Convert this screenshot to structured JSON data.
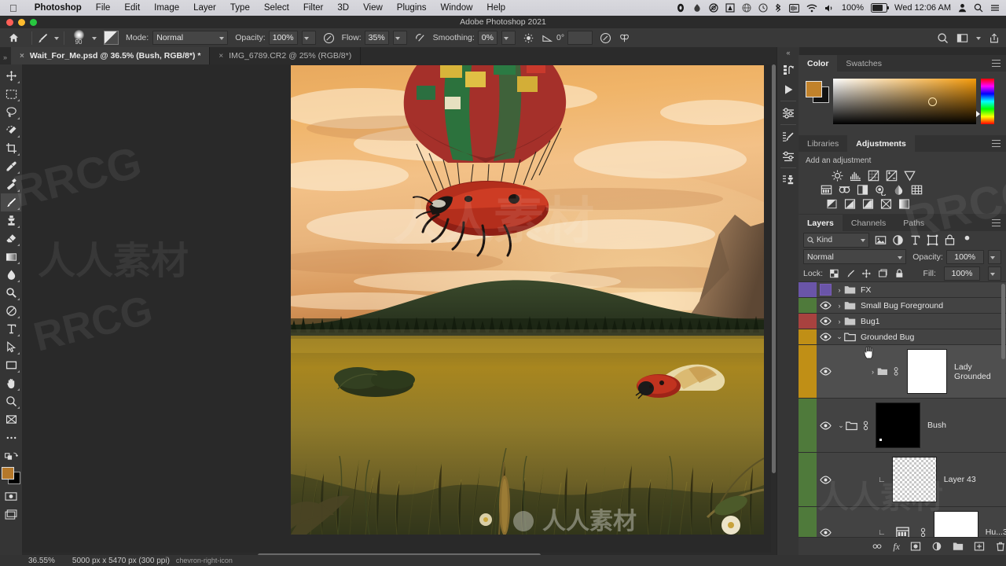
{
  "macbar": {
    "apple_icon": "apple-icon",
    "app_name": "Photoshop",
    "menus": [
      "File",
      "Edit",
      "Image",
      "Layer",
      "Type",
      "Select",
      "Filter",
      "3D",
      "View",
      "Plugins",
      "Window",
      "Help"
    ],
    "status_icons": [
      "dropbox-icon",
      "creative-cloud-icon",
      "adobe-icon",
      "globe-icon",
      "time-machine-icon",
      "bluetooth-icon",
      "battery-time-icon",
      "wifi-icon",
      "volume-icon"
    ],
    "battery_percent": "100%",
    "clock": "Wed 12:06 AM",
    "user_icon": "user-icon",
    "search_icon": "spotlight-search-icon",
    "control_center_icon": "control-center-icon"
  },
  "window": {
    "title": "Adobe Photoshop 2021"
  },
  "options_bar": {
    "home_icon": "home-icon",
    "tool_icon": "brush-tool-icon",
    "brush_size": "90",
    "brush_preset_icon": "brush-preset-picker-icon",
    "mode_label": "Mode:",
    "mode_value": "Normal",
    "opacity_label": "Opacity:",
    "opacity_value": "100%",
    "opacity_pressure_icon": "pressure-opacity-icon",
    "flow_label": "Flow:",
    "flow_value": "35%",
    "airbrush_icon": "airbrush-icon",
    "smoothing_label": "Smoothing:",
    "smoothing_value": "0%",
    "smoothing_options_icon": "smoothing-options-gear-icon",
    "angle_icon": "brush-angle-icon",
    "angle_value": "0°",
    "tablet_pressure_icon": "tablet-pressure-size-icon",
    "symmetry_icon": "symmetry-butterfly-icon",
    "search_icon": "search-icon",
    "workspace_icon": "workspace-switcher-icon",
    "share_icon": "share-icon"
  },
  "tabs": {
    "expander_icon": "double-chevron-icon",
    "items": [
      {
        "label": "Wait_For_Me.psd @ 36.5% (Bush, RGB/8*) *",
        "active": true,
        "close_icon": "close-icon"
      },
      {
        "label": "IMG_6789.CR2 @ 25% (RGB/8*)",
        "active": false,
        "close_icon": "close-icon"
      }
    ]
  },
  "toolbar": {
    "tools": [
      {
        "name": "move-tool-icon",
        "selected": false
      },
      {
        "name": "rectangular-marquee-tool-icon",
        "selected": false
      },
      {
        "name": "lasso-tool-icon",
        "selected": false
      },
      {
        "name": "object-selection-tool-icon",
        "selected": false
      },
      {
        "name": "crop-tool-icon",
        "selected": false
      },
      {
        "name": "eyedropper-tool-icon",
        "selected": false
      },
      {
        "name": "spot-healing-brush-tool-icon",
        "selected": false
      },
      {
        "name": "brush-tool-icon",
        "selected": true
      },
      {
        "name": "clone-stamp-tool-icon",
        "selected": false
      },
      {
        "name": "eraser-tool-icon",
        "selected": false
      },
      {
        "name": "gradient-tool-icon",
        "selected": false
      },
      {
        "name": "blur-tool-icon",
        "selected": false
      },
      {
        "name": "dodge-tool-icon",
        "selected": false
      },
      {
        "name": "pen-tool-icon",
        "selected": false
      },
      {
        "name": "type-tool-icon",
        "selected": false
      },
      {
        "name": "path-selection-tool-icon",
        "selected": false
      },
      {
        "name": "rectangle-tool-icon",
        "selected": false
      },
      {
        "name": "hand-tool-icon",
        "selected": false
      },
      {
        "name": "zoom-tool-icon",
        "selected": false
      },
      {
        "name": "edit-toolbar-icon",
        "selected": false
      },
      {
        "name": "more-tools-icon",
        "selected": false
      },
      {
        "name": "default-colors-icon",
        "selected": false
      }
    ],
    "foreground_color": "#b5782a",
    "background_color": "#000000",
    "quick_mask_icon": "quick-mask-mode-icon",
    "screen_mode_icon": "screen-mode-icon"
  },
  "canvas": {
    "description": "Surreal photo composite: hot air balloon with ladybug gondola flying over a sunset meadow and pine forest",
    "watermarks": [
      "RRCG",
      "人人素材"
    ]
  },
  "status_bar": {
    "zoom": "36.55%",
    "doc_size": "5000 px x 5470 px (300 ppi)",
    "expand_icon": "chevron-right-icon"
  },
  "dock_rail": {
    "collapse_icon": "double-chevron-left-icon",
    "items": [
      "history-icon",
      "play-actions-icon",
      "properties-icon",
      "brush-settings-icon",
      "brushes-icon",
      "clone-source-icon"
    ]
  },
  "color_panel": {
    "tabs": [
      {
        "label": "Color",
        "active": true
      },
      {
        "label": "Swatches",
        "active": false
      }
    ],
    "menu_icon": "panel-menu-icon",
    "foreground_swatch": "#c1822b",
    "background_swatch": "#111111",
    "picker_ring_icon": "color-picker-ring-icon",
    "hue_slider_icon": "hue-slider-icon"
  },
  "adjustments_panel": {
    "tabs": [
      {
        "label": "Libraries",
        "active": false
      },
      {
        "label": "Adjustments",
        "active": true
      }
    ],
    "menu_icon": "panel-menu-icon",
    "heading": "Add an adjustment",
    "row1": [
      "brightness-contrast-icon",
      "levels-icon",
      "curves-icon",
      "exposure-icon",
      "vibrance-icon"
    ],
    "row2": [
      "hue-saturation-icon",
      "color-balance-icon",
      "black-white-icon",
      "photo-filter-icon",
      "channel-mixer-icon",
      "color-lookup-icon"
    ],
    "row3": [
      "invert-icon",
      "posterize-icon",
      "threshold-icon",
      "selective-color-icon",
      "gradient-map-icon"
    ]
  },
  "layers_panel": {
    "tabs": [
      {
        "label": "Layers",
        "active": true
      },
      {
        "label": "Channels",
        "active": false
      },
      {
        "label": "Paths",
        "active": false
      }
    ],
    "menu_icon": "panel-menu-icon",
    "filter": {
      "search_icon": "search-icon",
      "kind_label": "Kind",
      "chevron_icon": "chevron-down-icon",
      "filter_icons": [
        "filter-pixel-icon",
        "filter-adjustment-icon",
        "filter-type-icon",
        "filter-shape-icon",
        "filter-smart-object-icon"
      ],
      "toggle_icon": "filter-toggle-icon"
    },
    "blend_mode": "Normal",
    "opacity_label": "Opacity:",
    "opacity_value": "100%",
    "lock_label": "Lock:",
    "lock_icons": [
      "lock-transparent-pixels-icon",
      "lock-image-pixels-icon",
      "lock-position-icon",
      "lock-artboard-nesting-icon",
      "lock-all-icon"
    ],
    "fill_label": "Fill:",
    "fill_value": "100%",
    "layers": [
      {
        "name": "FX",
        "type": "group",
        "color": "#6a55a8",
        "visible": false,
        "expanded": false,
        "twisty": "›"
      },
      {
        "name": "Small Bug Foreground",
        "type": "group",
        "color": "#4f7a3b",
        "visible": true,
        "expanded": false,
        "twisty": "›"
      },
      {
        "name": "Bug1",
        "type": "group",
        "color": "#a8423f",
        "visible": true,
        "expanded": false,
        "twisty": "›"
      },
      {
        "name": "Grounded Bug",
        "type": "group",
        "color": "#c08f16",
        "visible": true,
        "expanded": true,
        "twisty": "⌄"
      },
      {
        "name": "Lady Grounded",
        "type": "group-nested",
        "color": "#c08f16",
        "visible": true,
        "expanded": false,
        "twisty": "›",
        "thumb": "white",
        "has_mask_link": true,
        "selected": true
      },
      {
        "name": "Bush",
        "type": "group-nested",
        "color": "#4f7a3b",
        "visible": true,
        "expanded": true,
        "twisty": "⌄",
        "thumb": "black",
        "has_mask_link": true
      },
      {
        "name": "Layer 43",
        "type": "layer",
        "color": "#4f7a3b",
        "visible": true,
        "thumb": "checker",
        "clipped": true
      },
      {
        "name": "Hu...3",
        "type": "adjustment",
        "color": "#4f7a3b",
        "visible": true,
        "thumb": "white",
        "clipped": true,
        "adjustment_icon": "hue-saturation-icon",
        "has_mask_link": true
      }
    ],
    "footer_icons": [
      "link-layers-icon",
      "layer-style-fx-icon",
      "add-layer-mask-icon",
      "new-adjustment-layer-icon",
      "new-group-icon",
      "new-layer-icon",
      "delete-layer-icon"
    ],
    "cursor_icon": "pointing-hand-cursor-icon"
  }
}
